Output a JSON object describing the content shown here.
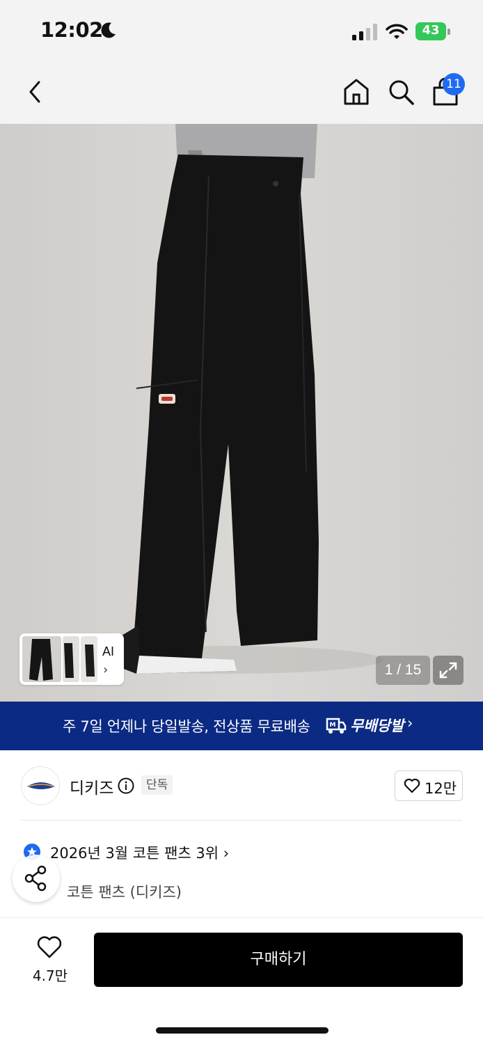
{
  "status_bar": {
    "time": "12:02",
    "battery_percent": "43",
    "icons": [
      "moon-icon",
      "signal-icon",
      "wifi-icon",
      "battery-charging-icon"
    ]
  },
  "header": {
    "icons": [
      "back-icon",
      "home-icon",
      "search-icon",
      "shopping-bag-icon"
    ],
    "cart_count": "11"
  },
  "gallery": {
    "thumbnail_label": "AI",
    "counter": "1 / 15",
    "expand_icon": "expand-icon"
  },
  "shipping_banner": {
    "text": "주 7일 언제나 당일발송, 전상품 무료배송",
    "brand": "무배당발",
    "background": "#0b2a84"
  },
  "brand": {
    "name": "디키즈",
    "badge": "단독",
    "likes": "12만"
  },
  "ranking": {
    "text": "2026년 3월 코튼 팬츠 3위",
    "category": "코튼 팬츠 (디키즈)",
    "accent": "#1f6bf0"
  },
  "bottom_bar": {
    "wish_count": "4.7만",
    "buy_label": "구매하기"
  }
}
